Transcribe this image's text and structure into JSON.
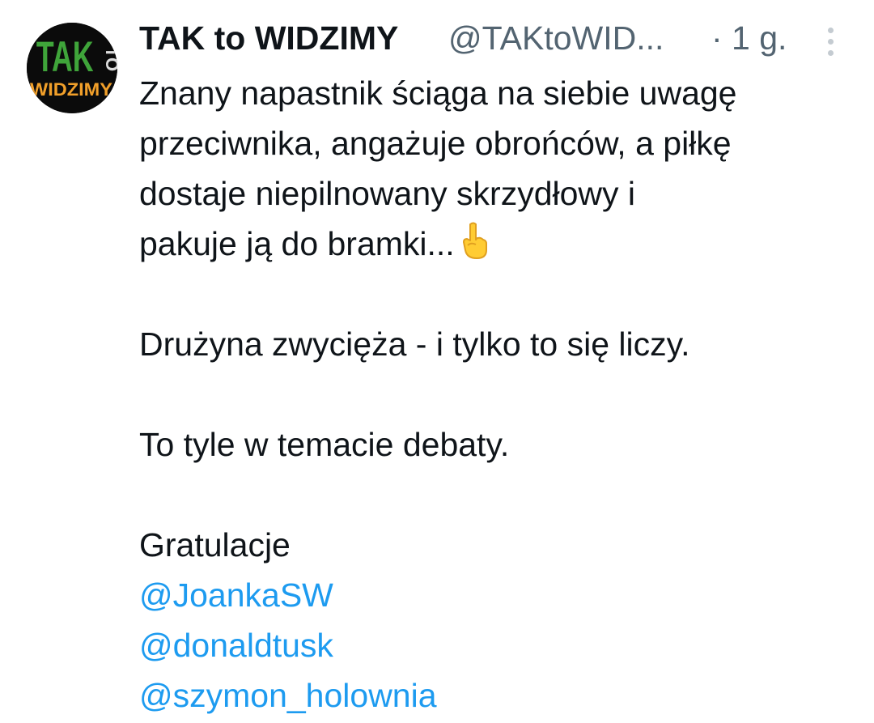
{
  "author": {
    "display_name": "TAK to WIDZIMY",
    "handle": "@TAKtoWID...",
    "separator": "·",
    "time": "1 g.",
    "avatar_text": {
      "top": "TAK",
      "side": "TO",
      "bottom": "WIDZIMY"
    }
  },
  "icons": {
    "more": "more-vertical-icon",
    "emoji": "index-pointing-up-emoji"
  },
  "tweet": {
    "paragraph1_lines": [
      "Znany napastnik ściąga na siebie uwagę",
      "przeciwnika, angażuje obrońców, a piłkę",
      "dostaje niepilnowany skrzydłowy i",
      "pakuje ją do bramki..."
    ],
    "paragraph2": "Drużyna zwycięża - i tylko to się liczy.",
    "paragraph3": "To tyle w temacie debaty.",
    "paragraph4": "Gratulacje",
    "mentions": [
      "@JoankaSW",
      "@donaldtusk",
      "@szymon_holownia"
    ]
  },
  "colors": {
    "text": "#0f1419",
    "secondary": "#536471",
    "link": "#1d9bf0",
    "avatar_green": "#3fa43a",
    "avatar_orange": "#f2a02a"
  }
}
